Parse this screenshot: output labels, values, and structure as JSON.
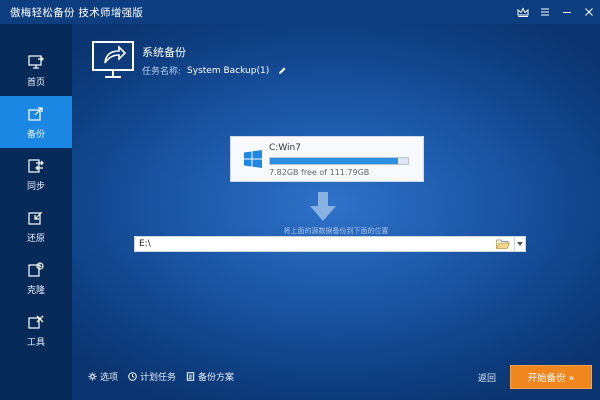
{
  "window": {
    "title": "傲梅轻松备份 技术师增强版"
  },
  "sidebar": {
    "items": [
      {
        "label": "首页",
        "icon": "home-icon",
        "active": false
      },
      {
        "label": "备份",
        "icon": "backup-icon",
        "active": true
      },
      {
        "label": "同步",
        "icon": "sync-icon",
        "active": false
      },
      {
        "label": "还原",
        "icon": "restore-icon",
        "active": false
      },
      {
        "label": "克隆",
        "icon": "clone-icon",
        "active": false
      },
      {
        "label": "工具",
        "icon": "tools-icon",
        "active": false
      }
    ]
  },
  "header": {
    "title": "系统备份",
    "task_label": "任务名称:",
    "task_name": "System Backup(1)"
  },
  "source": {
    "drive_name": "C:Win7",
    "free_text": "7.82GB free of 111.79GB",
    "used_fraction": 0.93
  },
  "hint": "将上面的源数据备份到下面的位置",
  "destination": {
    "path": "E:\\"
  },
  "footer": {
    "options_label": "选项",
    "schedule_label": "计划任务",
    "scheme_label": "备份方案",
    "back_label": "返回",
    "start_label": "开始备份 »"
  },
  "colors": {
    "accent": "#1a88e2",
    "start_button": "#f0861e",
    "sidebar_bg": "#072a58"
  }
}
